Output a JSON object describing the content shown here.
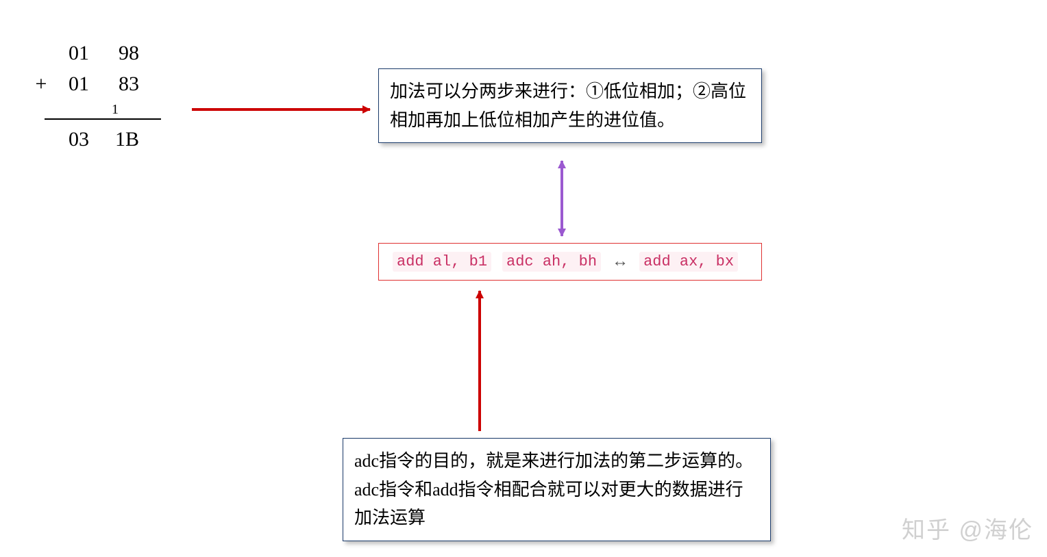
{
  "math": {
    "row1_hi": "01",
    "row1_lo": "98",
    "op": "+",
    "row2_hi": "01",
    "row2_lo": "83",
    "carry": "1",
    "result_hi": "03",
    "result_lo": "1B"
  },
  "box1": {
    "text": "加法可以分两步来进行：①低位相加；②高位相加再加上低位相加产生的进位值。"
  },
  "code": {
    "part1": "add al, b1",
    "part2": "adc ah, bh",
    "equiv": "↔",
    "part3": "add ax, bx"
  },
  "box3": {
    "text": "adc指令的目的，就是来进行加法的第二步运算的。adc指令和add指令相配合就可以对更大的数据进行加法运算"
  },
  "watermark": "知乎 @海伦"
}
